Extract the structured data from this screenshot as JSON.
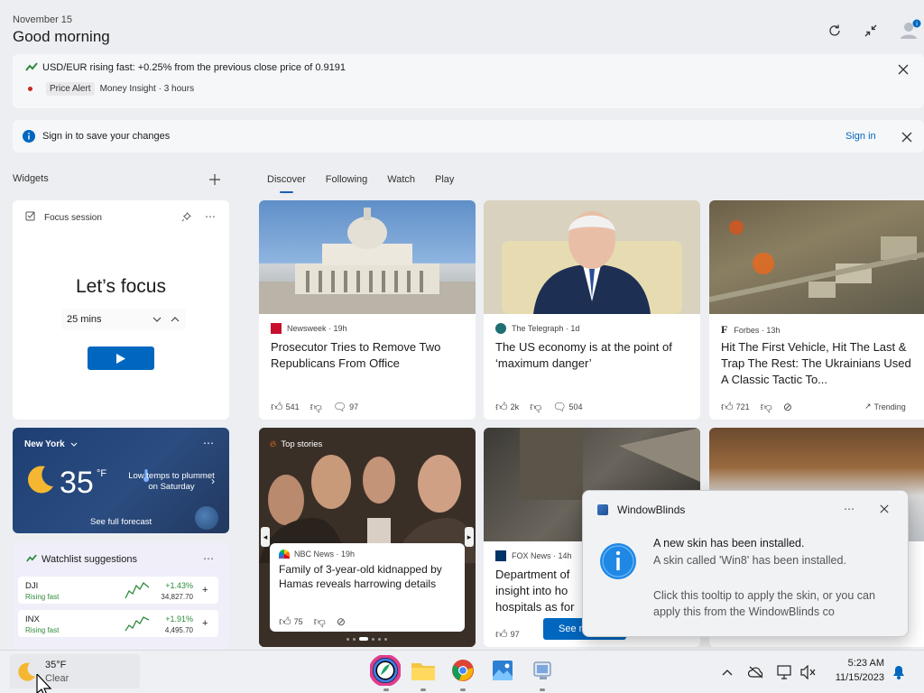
{
  "header": {
    "date": "November 15",
    "greeting": "Good morning"
  },
  "alert": {
    "text": "USD/EUR rising fast: +0.25% from the previous close price of 0.9191",
    "tag": "Price Alert",
    "source": "Money Insight · 3 hours"
  },
  "signin_banner": {
    "text": "Sign in to save your changes",
    "link": "Sign in"
  },
  "widgets": {
    "label": "Widgets",
    "focus": {
      "title": "Focus session",
      "heading": "Let’s focus",
      "duration": "25 mins"
    },
    "weather": {
      "city": "New York",
      "temp": "35",
      "unit": "°F",
      "note": "Low temps to plummet on Saturday",
      "forecast_link": "See full forecast"
    },
    "watchlist": {
      "title": "Watchlist suggestions",
      "items": [
        {
          "symbol": "DJI",
          "status": "Rising fast",
          "change": "+1.43%",
          "value": "34,827.70"
        },
        {
          "symbol": "INX",
          "status": "Rising fast",
          "change": "+1.91%",
          "value": "4,495.70"
        }
      ]
    }
  },
  "tabs": [
    "Discover",
    "Following",
    "Watch",
    "Play"
  ],
  "news": [
    {
      "source": "Newsweek · 19h",
      "headline": "Prosecutor Tries to Remove Two Republicans From Office",
      "likes": "541",
      "comments": "97"
    },
    {
      "source": "The Telegraph · 1d",
      "headline": "The US economy is at the point of ‘maximum danger’",
      "likes": "2k",
      "comments": "504"
    },
    {
      "source": "Forbes · 13h",
      "headline": "Hit The First Vehicle, Hit The Last & Trap The Rest: The Ukrainians Used A Classic Tactic To...",
      "likes": "721",
      "trending": "Trending"
    },
    {
      "label": "Top stories",
      "source": "NBC News · 19h",
      "headline": "Family of 3-year-old kidnapped by Hamas reveals harrowing details",
      "likes": "75"
    },
    {
      "source": "FOX News · 14h",
      "headline_lines": [
        "Department of",
        "insight into ho",
        "hospitals as for"
      ],
      "likes": "97",
      "see_more": "See m"
    }
  ],
  "toast": {
    "app": "WindowBlinds",
    "title": "A new skin has been installed.",
    "line1": "A skin called 'Win8' has been installed.",
    "line2": "Click this tooltip to apply the skin, or you can apply this from the WindowBlinds co"
  },
  "taskbar": {
    "weather_temp": "35°F",
    "weather_desc": "Clear",
    "time": "5:23 AM",
    "date": "11/15/2023"
  },
  "colors": {
    "accent": "#0067c0",
    "rising": "#2e8b3a",
    "alert_dot": "#c42b1c"
  }
}
